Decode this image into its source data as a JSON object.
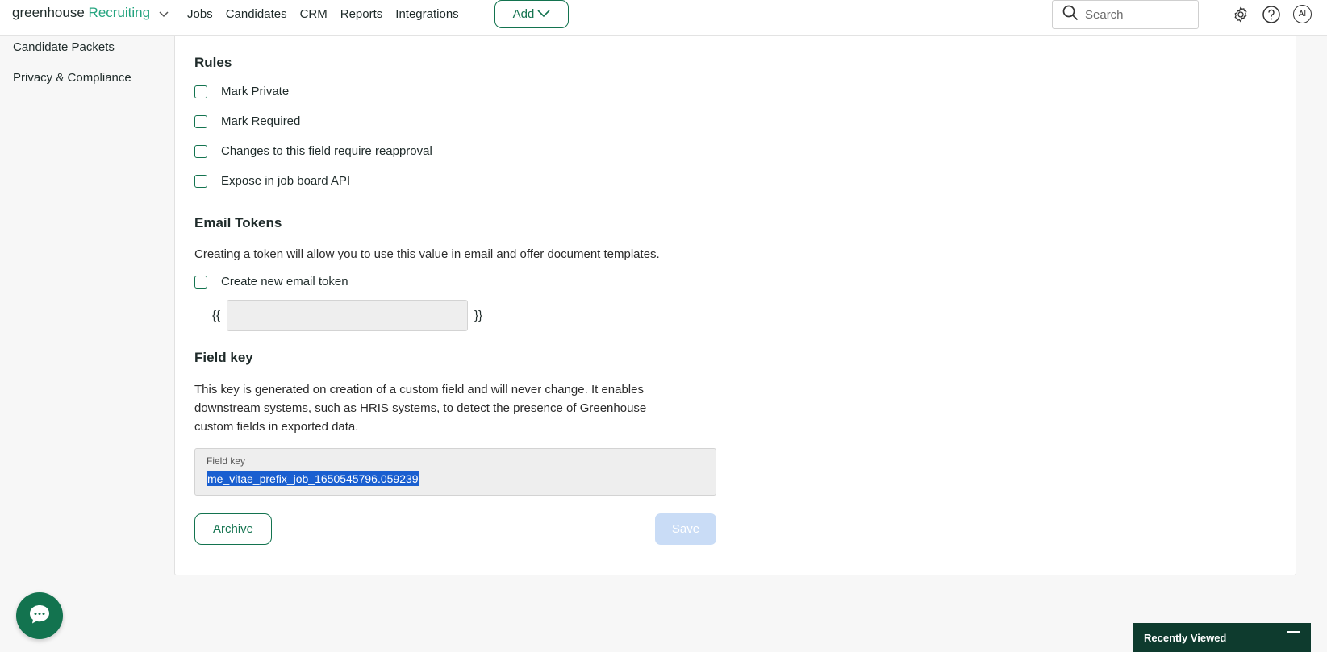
{
  "nav": {
    "brand_primary": "greenhouse",
    "brand_secondary": "Recruiting",
    "links": [
      "Jobs",
      "Candidates",
      "CRM",
      "Reports",
      "Integrations"
    ],
    "add_label": "Add",
    "search_placeholder": "Search",
    "avatar_initials": "AI",
    "icons": [
      "settings-gear-icon",
      "help-icon"
    ]
  },
  "sidebar": {
    "items": [
      {
        "label": "Candidate Packets"
      },
      {
        "label": "Privacy & Compliance"
      }
    ]
  },
  "rules": {
    "title": "Rules",
    "options": [
      {
        "label": "Mark Private",
        "checked": false
      },
      {
        "label": "Mark Required",
        "checked": false
      },
      {
        "label": "Changes to this field require reapproval",
        "checked": false
      },
      {
        "label": "Expose in job board API",
        "checked": false
      }
    ]
  },
  "email_tokens": {
    "title": "Email Tokens",
    "description": "Creating a token will allow you to use this value in email and offer document templates.",
    "create_label": "Create new email token",
    "open_brace": "{{",
    "close_brace": "}}",
    "token_value": ""
  },
  "field_key": {
    "title": "Field key",
    "description": "This key is generated on creation of a custom field and will never change. It enables downstream systems, such as HRIS systems, to detect the presence of Greenhouse custom fields in exported data.",
    "box_label": "Field key",
    "value": "me_vitae_prefix_job_1650545796.059239"
  },
  "actions": {
    "archive_label": "Archive",
    "save_label": "Save"
  },
  "recently_viewed": {
    "label": "Recently Viewed"
  },
  "colors": {
    "brand_green": "#13734f",
    "accent_green": "#24a47f",
    "dark_green": "#0e3b2e",
    "selection_blue": "#1a5fd0",
    "disabled_save": "#c9dcf6"
  }
}
